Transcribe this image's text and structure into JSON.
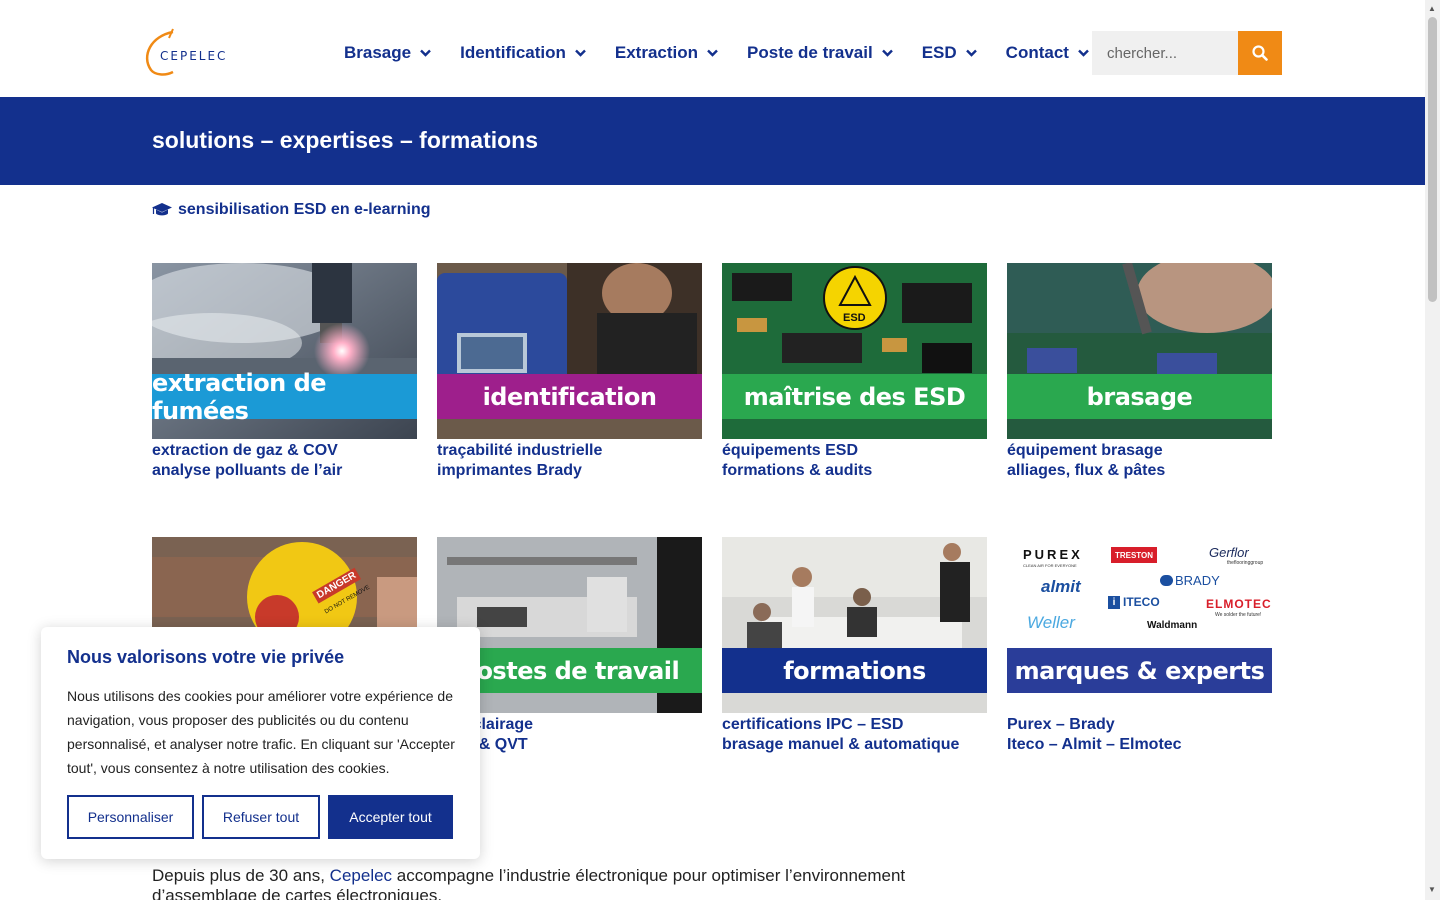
{
  "header": {
    "logo_text": "CEPELEC",
    "nav": [
      {
        "label": "Brasage"
      },
      {
        "label": "Identification"
      },
      {
        "label": "Extraction"
      },
      {
        "label": "Poste de travail"
      },
      {
        "label": "ESD"
      },
      {
        "label": "Contact"
      }
    ],
    "search_placeholder": "chercher..."
  },
  "banner": {
    "title": "solutions – expertises – formations"
  },
  "elearning": {
    "label": "sensibilisation ESD en e-learning"
  },
  "cards": [
    {
      "label": "extraction de fumées",
      "line1": "extraction de gaz & COV",
      "line2": "analyse polluants de l’air",
      "color": "#1b9ad6"
    },
    {
      "label": "identification",
      "line1": "traçabilité industrielle",
      "line2": "imprimantes Brady",
      "color": "#9e1f8c"
    },
    {
      "label": "maîtrise des ESD",
      "line1": "équipements ESD",
      "line2": "formations & audits",
      "color": "#2aa84f",
      "badge": "ESD"
    },
    {
      "label": "brasage",
      "line1": "équipement brasage",
      "line2": "alliages, flux & pâtes",
      "color": "#2aa84f"
    },
    {
      "label": "",
      "line1": "",
      "line2": "",
      "color": "#9b1f7f",
      "danger1": "DANGER",
      "danger2": "DO NOT REMOVE"
    },
    {
      "label": "postes de travail",
      "line1": "s – éclairage",
      "line2": "omie & QVT",
      "color": "#2aa84f"
    },
    {
      "label": "formations",
      "line1": "certifications IPC – ESD",
      "line2": "brasage manuel & automatique",
      "color": "#13308d"
    },
    {
      "label": "marques & experts",
      "line1": "Purex – Brady",
      "line2": "Iteco – Almit – Elmotec",
      "color": "#2a3d99"
    }
  ],
  "brands": {
    "purex": "PUREX",
    "purex_sub": "CLEAN AIR FOR EVERYONE",
    "treston": "TRESTON",
    "gerflor": "Gerflor",
    "gerflor_sub": "theflooringgroup",
    "almit": "almit",
    "brady": "BRADY",
    "iteco": "ITECO",
    "elmotec": "ELMOTEC",
    "elmotec_sub": "We solder the future!",
    "weller": "Weller",
    "waldmann": "Waldmann"
  },
  "intro": {
    "before": "Depuis plus de 30 ans, ",
    "link": "Cepelec",
    "after": " accompagne l’industrie électronique pour optimiser l’environnement d’assemblage de cartes électroniques."
  },
  "cookie": {
    "title": "Nous valorisons votre vie privée",
    "text": "Nous utilisons des cookies pour améliorer votre expérience de navigation, vous proposer des publicités ou du contenu personnalisé, et analyser notre trafic. En cliquant sur 'Accepter tout', vous consentez à notre utilisation des cookies.",
    "customize": "Personnaliser",
    "reject": "Refuser tout",
    "accept": "Accepter tout"
  },
  "colors": {
    "brand_blue": "#13308d",
    "accent_orange": "#f08a15"
  }
}
